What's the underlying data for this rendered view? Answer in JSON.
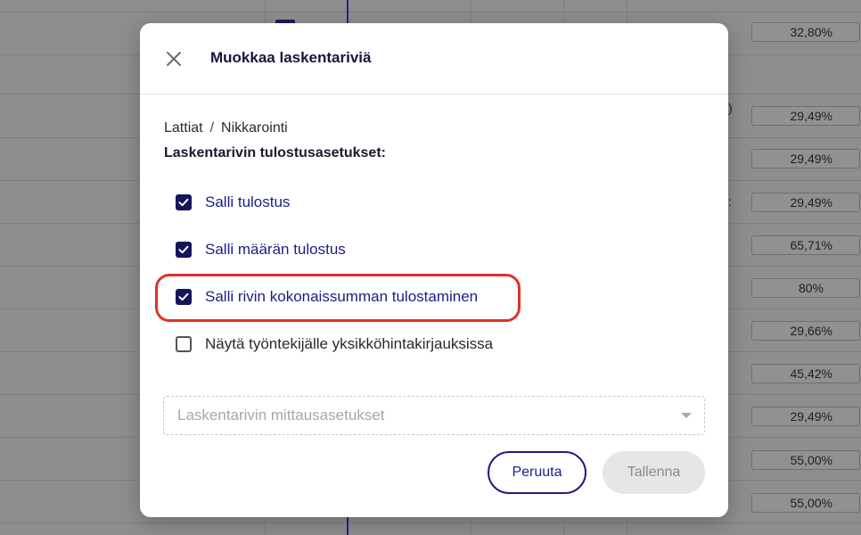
{
  "background": {
    "percent_cells": [
      "32,80%",
      "29,49%",
      "29,49%",
      "29,49%",
      "65,71%",
      "80%",
      "29,66%",
      "45,42%",
      "29,49%",
      "55,00%",
      "55,00%"
    ]
  },
  "modal": {
    "title": "Muokkaa laskentariviä",
    "close_icon": "close-icon",
    "breadcrumb": {
      "part1": "Lattiat",
      "separator": "/",
      "part2": "Nikkarointi"
    },
    "section_label": "Laskentarivin tulostusasetukset:",
    "options": [
      {
        "label": "Salli tulostus",
        "checked": true
      },
      {
        "label": "Salli määrän tulostus",
        "checked": true
      },
      {
        "label": "Salli rivin kokonaissumman tulostaminen",
        "checked": true,
        "highlighted": true
      },
      {
        "label": "Näytä työntekijälle yksikköhintakirjauksissa",
        "checked": false
      }
    ],
    "measure_select": {
      "placeholder": "Laskentarivin mittausasetukset"
    },
    "buttons": {
      "cancel": "Peruuta",
      "save": "Tallenna"
    }
  },
  "colors": {
    "accent": "#1d1d86",
    "highlight": "#e0312a",
    "overlay": "#8e8e8e"
  }
}
